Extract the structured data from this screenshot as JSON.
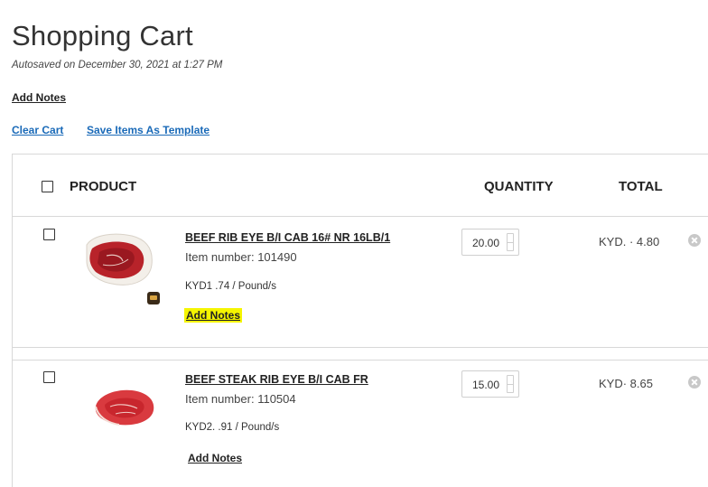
{
  "page": {
    "title": "Shopping Cart",
    "autosave": "Autosaved on December 30, 2021 at 1:27 PM",
    "add_notes": "Add Notes",
    "clear_cart": "Clear Cart",
    "save_template": "Save Items As Template"
  },
  "table": {
    "headers": {
      "product": "PRODUCT",
      "quantity": "QUANTITY",
      "total": "TOTAL"
    }
  },
  "items": [
    {
      "title": "BEEF RIB EYE B/I CAB 16# NR 16LB/1",
      "item_number": "Item number: 101490",
      "price": "KYD1  .74 / Pound/s",
      "add_notes": "Add Notes",
      "quantity": "20.00",
      "total": "KYD.  · 4.80",
      "icon": "ribeye-roast-image",
      "has_badge": true
    },
    {
      "title": "BEEF STEAK RIB EYE B/I CAB FR",
      "item_number": "Item number: 110504",
      "price": "KYD2.  .91 / Pound/s",
      "add_notes": "Add Notes",
      "quantity": "15.00",
      "total": "KYD·   8.65",
      "icon": "ribeye-steak-image",
      "has_badge": false
    }
  ],
  "colors": {
    "link": "#1a6ab8",
    "highlight": "#f5f500",
    "border": "#d8d8d8"
  }
}
